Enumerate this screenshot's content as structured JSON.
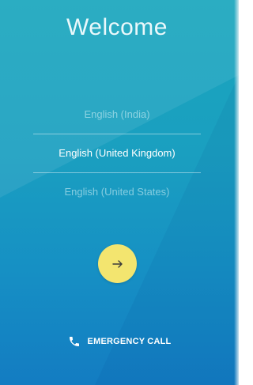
{
  "welcome": {
    "title": "Welcome"
  },
  "languages": [
    {
      "label": "English (India)",
      "state": "dim"
    },
    {
      "label": "English (United Kingdom)",
      "state": "selected"
    },
    {
      "label": "English (United States)",
      "state": "dim"
    }
  ],
  "next_button": {
    "icon": "arrow-right-icon"
  },
  "emergency": {
    "label": "EMERGENCY CALL",
    "icon": "phone-icon"
  },
  "colors": {
    "background_top": "#1aa6bd",
    "background_bottom": "#137cc2",
    "next_button": "#f3e56f",
    "text": "#ffffff"
  }
}
